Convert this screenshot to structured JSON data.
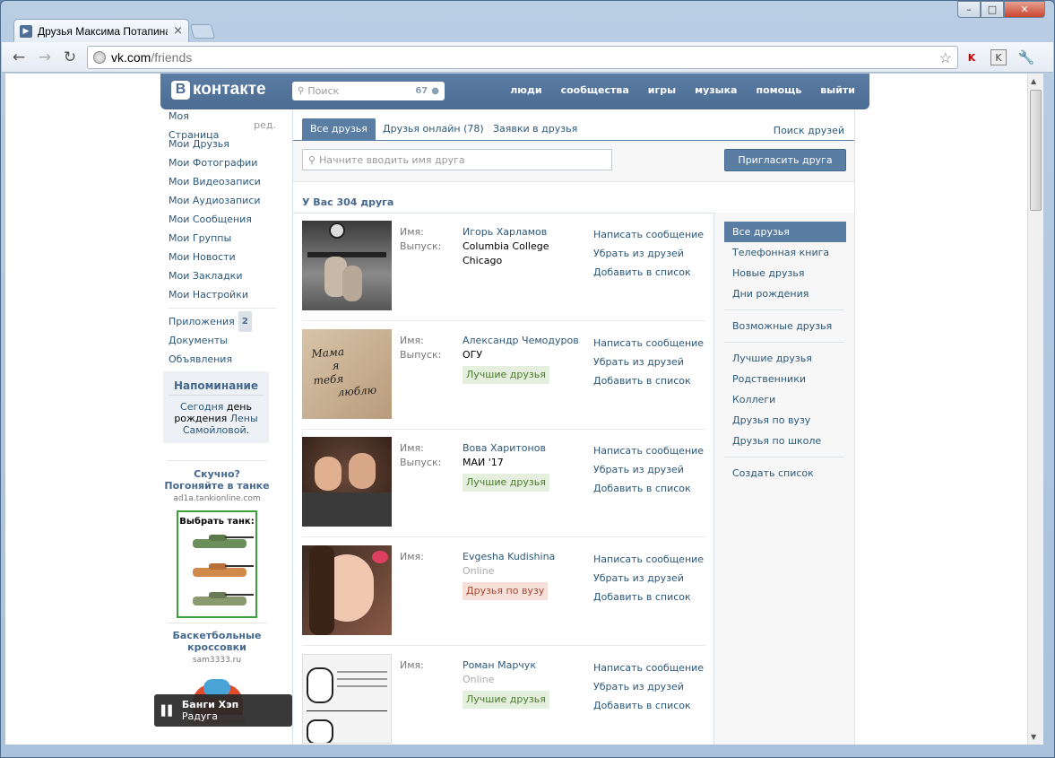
{
  "browser": {
    "tab_title": "Друзья Максима Потапина",
    "url_host": "vk.com",
    "url_path": "/friends"
  },
  "vk": {
    "logo_text": "контакте",
    "logo_letter": "В",
    "search_placeholder": "Поиск",
    "search_count": "67",
    "nav": [
      "люди",
      "сообщества",
      "игры",
      "музыка",
      "помощь",
      "выйти"
    ]
  },
  "leftmenu": {
    "items": [
      "Моя Страница",
      "Мои Друзья",
      "Мои Фотографии",
      "Мои Видеозаписи",
      "Мои Аудиозаписи",
      "Мои Сообщения",
      "Мои Группы",
      "Мои Новости",
      "Мои Закладки",
      "Мои Настройки"
    ],
    "edit": "ред.",
    "apps": "Приложения",
    "apps_badge": "2",
    "docs": "Документы",
    "ads": "Объявления"
  },
  "reminder": {
    "title": "Напоминание",
    "today": "Сегодня",
    "text1": " день рождения ",
    "name": "Лены Самойловой",
    "end": "."
  },
  "ad1": {
    "title": "Скучно? Погоняйте в танке",
    "domain": "ad1a.tankionline.com",
    "box_title": "Выбрать танк:"
  },
  "ad2": {
    "title": "Баскетбольные кроссовки",
    "domain": "sam3333.ru"
  },
  "player": {
    "artist": "Банги Хэп",
    "track": "Радуга"
  },
  "main": {
    "tabs": [
      "Все друзья",
      "Друзья онлайн (78)",
      "Заявки в друзья"
    ],
    "find_friends": "Поиск друзей",
    "friend_input_placeholder": "Начните вводить имя друга",
    "invite_button": "Пригласить друга",
    "count_header": "У Вас 304 друга",
    "label_name": "Имя:",
    "label_edu": "Выпуск:",
    "actions": [
      "Написать сообщение",
      "Убрать из друзей",
      "Добавить в список"
    ]
  },
  "friends": [
    {
      "name": "Игорь Харламов",
      "edu": "Columbia College Chicago",
      "online": "",
      "tag": "",
      "tag_color": ""
    },
    {
      "name": "Александр Чемодуров",
      "edu": "ОГУ",
      "online": "",
      "tag": "Лучшие друзья",
      "tag_color": "green"
    },
    {
      "name": "Вова Харитонов",
      "edu": "МАИ '17",
      "online": "",
      "tag": "Лучшие друзья",
      "tag_color": "green"
    },
    {
      "name": "Evgesha Kudishina",
      "edu": "",
      "online": "Online",
      "tag": "Друзья по вузу",
      "tag_color": "red"
    },
    {
      "name": "Роман Марчук",
      "edu": "",
      "online": "Online",
      "tag": "Лучшие друзья",
      "tag_color": "green"
    }
  ],
  "photo_text": [
    "Мама",
    "я",
    "тебя",
    "люблю"
  ],
  "rightmenu": {
    "group1": [
      "Все друзья",
      "Телефонная книга",
      "Новые друзья",
      "Дни рождения"
    ],
    "group2": [
      "Возможные друзья"
    ],
    "group3": [
      "Лучшие друзья",
      "Родственники",
      "Коллеги",
      "Друзья по вузу",
      "Друзья по школе"
    ],
    "group4": [
      "Создать список"
    ]
  }
}
